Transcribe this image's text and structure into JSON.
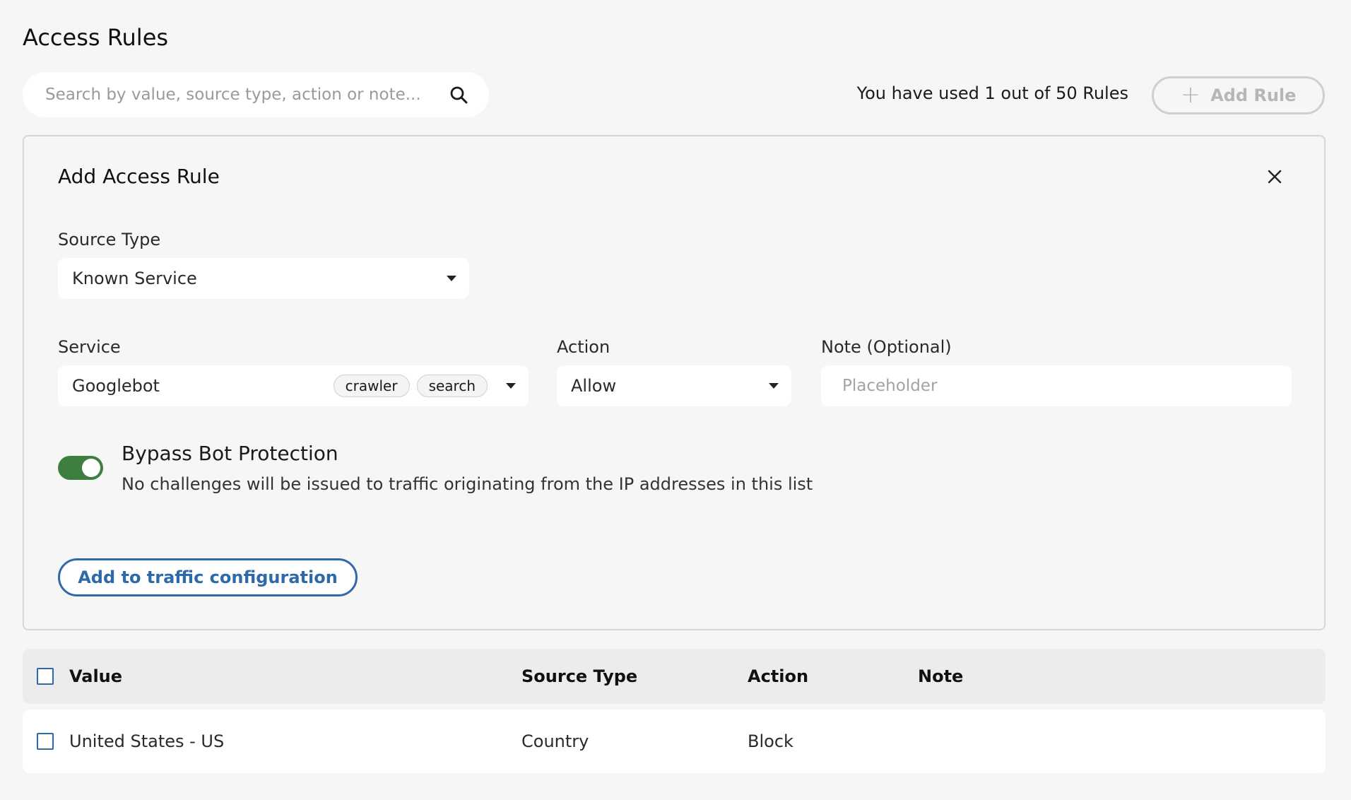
{
  "header": {
    "title": "Access Rules",
    "search_placeholder": "Search by value, source type, action or note...",
    "usage_text": "You have used 1 out of 50 Rules",
    "add_rule_label": "Add Rule"
  },
  "panel": {
    "title": "Add Access Rule",
    "source_type": {
      "label": "Source Type",
      "value": "Known Service"
    },
    "service": {
      "label": "Service",
      "value": "Googlebot",
      "tags": [
        "crawler",
        "search"
      ]
    },
    "action": {
      "label": "Action",
      "value": "Allow"
    },
    "note": {
      "label": "Note (Optional)",
      "placeholder": "Placeholder",
      "value": ""
    },
    "bypass": {
      "title": "Bypass Bot Protection",
      "description": "No challenges will be issued to traffic originating from the IP addresses in this list",
      "enabled": true
    },
    "submit_label": "Add to traffic configuration"
  },
  "table": {
    "headers": [
      "Value",
      "Source Type",
      "Action",
      "Note"
    ],
    "rows": [
      {
        "value": "United States - US",
        "source_type": "Country",
        "action": "Block",
        "note": ""
      }
    ]
  },
  "colors": {
    "background": "#f6f6f6",
    "accent_blue": "#2f6aa8",
    "toggle_green": "#3e7e3f",
    "disabled_gray": "#b6b6b6"
  }
}
